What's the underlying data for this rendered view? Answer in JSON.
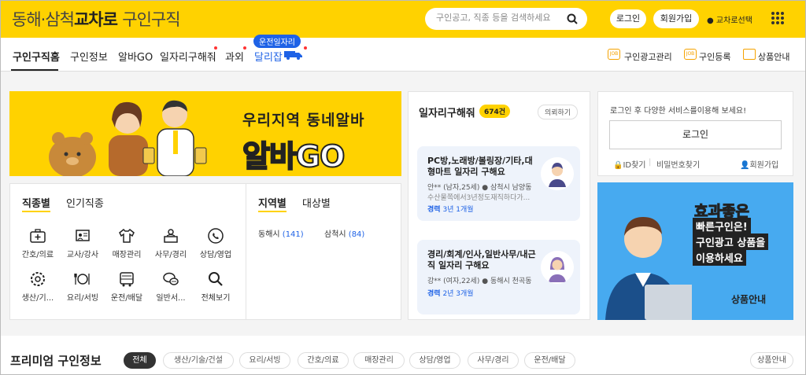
{
  "header": {
    "logo_prefix": "동해·삼척",
    "logo_brand": "교차로",
    "logo_suffix": "구인구직",
    "search_placeholder": "구인공고, 직종 등을 검색하세요",
    "login": "로그인",
    "signup": "회원가입",
    "region": "교차로선택",
    "brand_color": "#ffd200"
  },
  "nav": {
    "items": [
      "구인구직홈",
      "구인정보",
      "알바GO",
      "일자리구해줘",
      "과외",
      "달리잡"
    ],
    "bubble": "운전일자리",
    "right": [
      "구인광고관리",
      "구인등록",
      "상품안내"
    ]
  },
  "banner": {
    "line1": "우리지역 동네알바",
    "line2": "알바GO"
  },
  "jobs": {
    "tabs": [
      "직종별",
      "인기직종"
    ],
    "categories": [
      "간호/의료",
      "교사/강사",
      "매장관리",
      "사무/경리",
      "상담/영업",
      "생산/기...",
      "요리/서빙",
      "운전/배달",
      "일반서...",
      "전체보기"
    ],
    "region_tabs": [
      "지역별",
      "대상별"
    ],
    "regions": [
      {
        "name": "동해시",
        "count": "(141)"
      },
      {
        "name": "삼척시",
        "count": "(84)"
      }
    ]
  },
  "seekers": {
    "title": "일자리구해줘",
    "badge": "674건",
    "more": "의뢰하기",
    "cards": [
      {
        "title": "PC방,노래방/볼링장/기타,대형마트 일자리 구해요",
        "name": "안**",
        "info": "(남자,25세)",
        "loc": "삼척시 남양동",
        "desc": "수산물쪽에서3년정도재직하다가...",
        "exp_label": "경력",
        "exp": "3년 1개월"
      },
      {
        "title": "경리/회계/인사,일반사무/내근직 일자리 구해요",
        "name": "강**",
        "info": "(여자,22세)",
        "loc": "동해시 천곡동",
        "desc": "",
        "exp_label": "경력",
        "exp": "2년 3개월"
      }
    ]
  },
  "login_box": {
    "message": "로그인 후 다양한 서비스를이용해 보세요!",
    "button": "로그인",
    "find_id": "ID찾기",
    "find_pw": "비밀번호찾기",
    "join": "회원가입"
  },
  "ad": {
    "line1": "효과좋은",
    "line2": "빠른구인은!",
    "line3": "구인광고 상품을",
    "line4": "이용하세요",
    "cta": "상품안내"
  },
  "premium": {
    "title": "프리미엄 구인정보",
    "chips": [
      "전체",
      "생산/기술/건설",
      "요리/서빙",
      "간호/의료",
      "매장관리",
      "상담/영업",
      "사무/경리",
      "운전/배달"
    ],
    "right_button": "상품안내"
  }
}
